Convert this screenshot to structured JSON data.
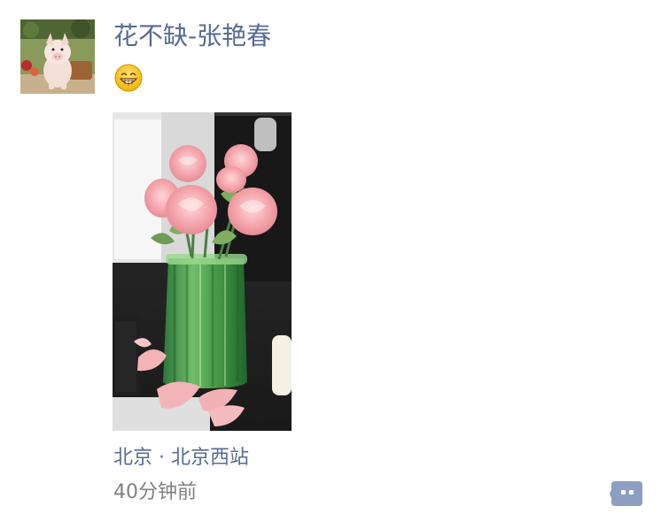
{
  "post": {
    "author_name": "花不缺-张艳春",
    "status_emoji": "grinning-face-emoji",
    "location": "北京 · 北京西站",
    "timestamp": "40分钟前",
    "image_description": "Pink roses in a green glass vase on a desk",
    "comment_icon": "comment-dots-icon"
  },
  "theme": {
    "name_color": "#576B95",
    "time_color": "#808080",
    "comment_button_color": "#8C9FC3"
  }
}
